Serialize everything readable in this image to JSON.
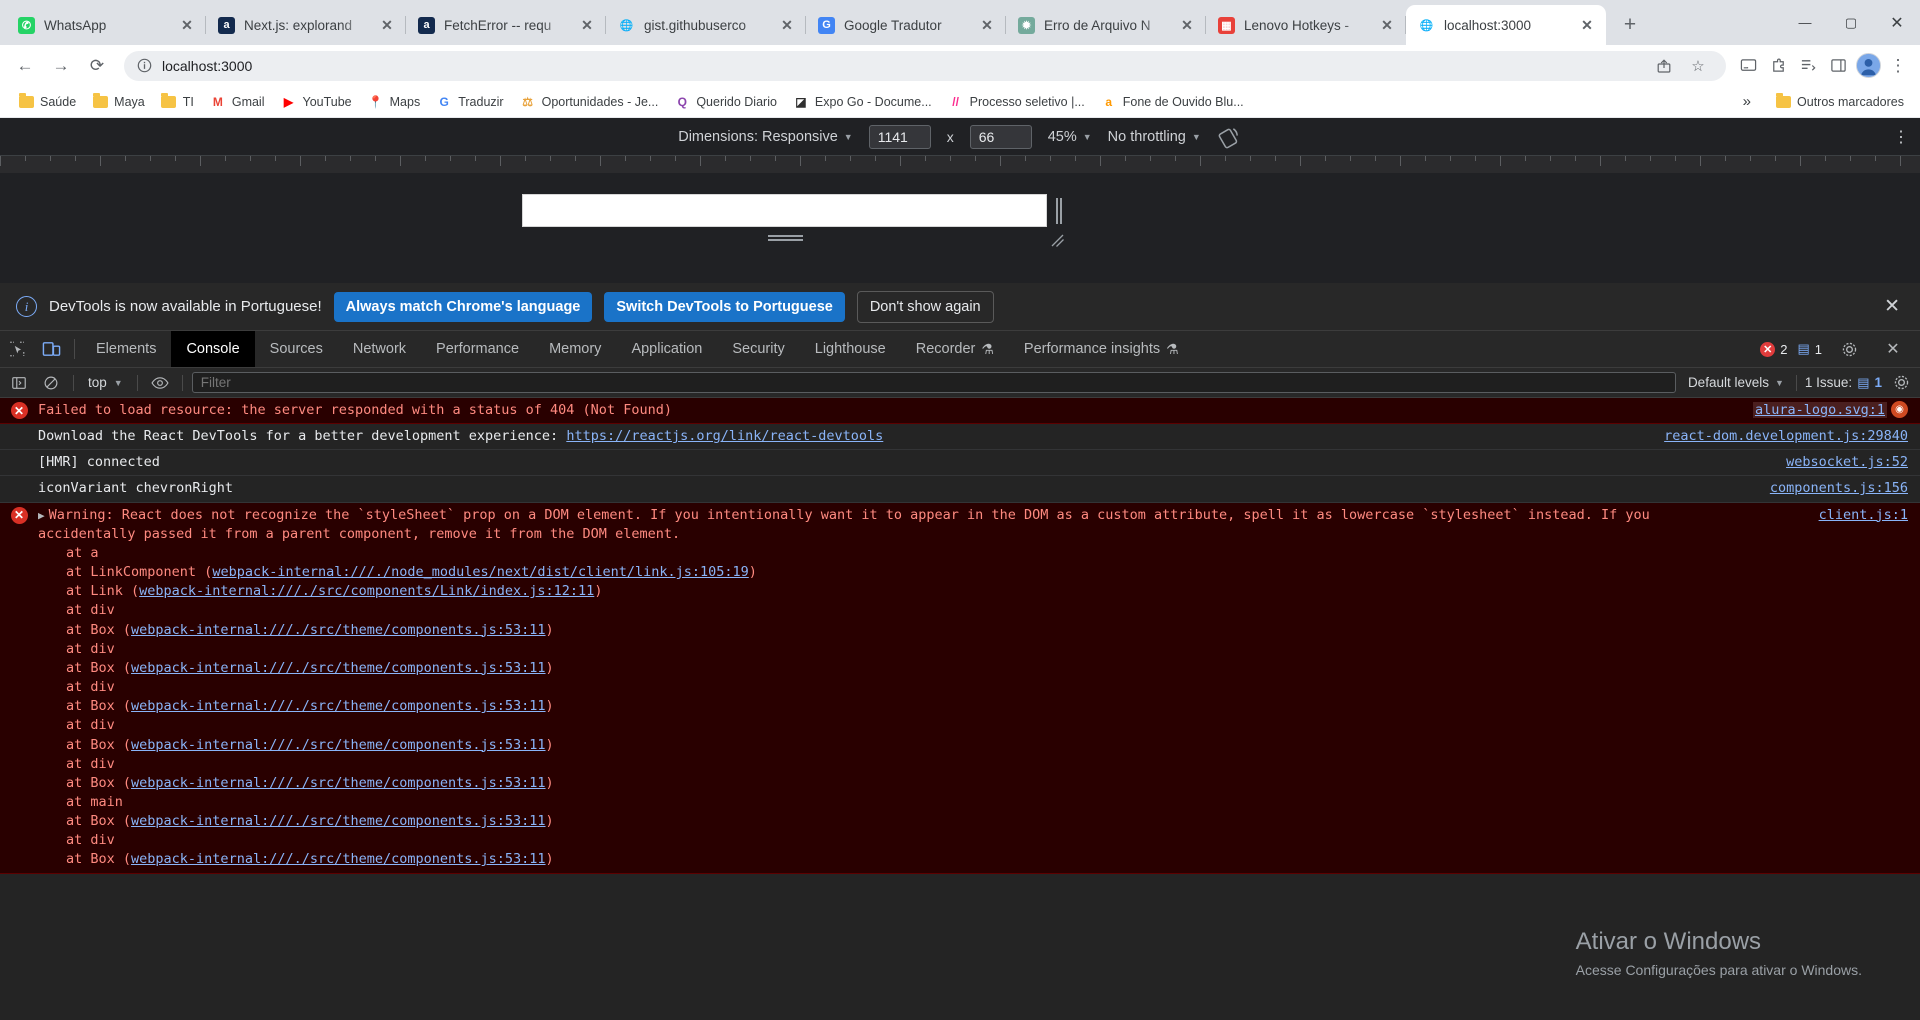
{
  "browser": {
    "tabs": [
      {
        "title": "WhatsApp",
        "favicon": "whatsapp-icon",
        "color": "#25d366",
        "glyph": "✆",
        "active": false
      },
      {
        "title": "Next.js: explorand",
        "favicon": "alura-icon",
        "color": "#132a4e",
        "glyph": "a",
        "active": false
      },
      {
        "title": "FetchError -- requ",
        "favicon": "alura-icon",
        "color": "#132a4e",
        "glyph": "a",
        "active": false
      },
      {
        "title": "gist.githubuserco",
        "favicon": "globe-icon",
        "color": "#c9cdd2",
        "glyph": "🌐",
        "active": false
      },
      {
        "title": "Google Tradutor",
        "favicon": "google-translate-icon",
        "color": "#4285f4",
        "glyph": "G",
        "active": false
      },
      {
        "title": "Erro de Arquivo N",
        "favicon": "chatgpt-icon",
        "color": "#74aa9c",
        "glyph": "✹",
        "active": false
      },
      {
        "title": "Lenovo Hotkeys -",
        "favicon": "microsoft-store-icon",
        "color": "#e8413a",
        "glyph": "▦",
        "active": false
      },
      {
        "title": "localhost:3000",
        "favicon": "globe-icon",
        "color": "#c9cdd2",
        "glyph": "🌐",
        "active": true
      }
    ],
    "new_tab_label": "+",
    "window_controls": {
      "minimize": "—",
      "maximize": "▢",
      "close": "✕"
    },
    "toolbar": {
      "back": "←",
      "forward": "→",
      "reload": "⟳",
      "site_info_icon": "info-circle-icon",
      "url": "localhost:3000",
      "share_icon": "↥",
      "bookmark_icon": "☆",
      "cast_icon": "▭",
      "extensions_icon": "🧩",
      "reading_list_icon": "☰",
      "side_panel_icon": "◫",
      "profile_icon": "avatar",
      "menu_icon": "⋮"
    },
    "bookmarks": [
      {
        "label": "Saúde",
        "icon": "folder-icon"
      },
      {
        "label": "Maya",
        "icon": "folder-icon"
      },
      {
        "label": "TI",
        "icon": "folder-icon"
      },
      {
        "label": "Gmail",
        "icon": "gmail-icon",
        "glyph": "M",
        "color": "#ea4335"
      },
      {
        "label": "YouTube",
        "icon": "youtube-icon",
        "glyph": "▶",
        "color": "#ff0000"
      },
      {
        "label": "Maps",
        "icon": "maps-icon",
        "glyph": "📍",
        "color": "#34a853"
      },
      {
        "label": "Traduzir",
        "icon": "google-translate-icon",
        "glyph": "G",
        "color": "#4285f4"
      },
      {
        "label": "Oportunidades - Je...",
        "icon": "scale-icon",
        "glyph": "⚖",
        "color": "#e8a33d"
      },
      {
        "label": "Querido Diario",
        "icon": "querido-diario-icon",
        "glyph": "Q",
        "color": "#8b44ad"
      },
      {
        "label": "Expo Go - Docume...",
        "icon": "expo-icon",
        "glyph": "◪",
        "color": "#2f2f2f"
      },
      {
        "label": "Processo seletivo |...",
        "icon": "gitlab-icon",
        "glyph": "//",
        "color": "#fc2c8f"
      },
      {
        "label": "Fone de Ouvido Blu...",
        "icon": "amazon-icon",
        "glyph": "a",
        "color": "#ff9900"
      }
    ],
    "bookmarks_overflow": "»",
    "other_bookmarks": "Outros marcadores"
  },
  "device_toolbar": {
    "dimensions_label": "Dimensions: Responsive",
    "width": "1141",
    "times": "x",
    "height": "66",
    "zoom": "45%",
    "throttling": "No throttling",
    "rotate_icon": "rotate-device-icon",
    "menu_icon": "⋮"
  },
  "language_banner": {
    "message": "DevTools is now available in Portuguese!",
    "always_match": "Always match Chrome's language",
    "switch": "Switch DevTools to Portuguese",
    "dismiss": "Don't show again",
    "close": "✕"
  },
  "devtools": {
    "inspect_icon": "inspect-element-icon",
    "device_icon": "toggle-device-toolbar-icon",
    "tabs": [
      {
        "label": "Elements",
        "active": false
      },
      {
        "label": "Console",
        "active": true
      },
      {
        "label": "Sources",
        "active": false
      },
      {
        "label": "Network",
        "active": false
      },
      {
        "label": "Performance",
        "active": false
      },
      {
        "label": "Memory",
        "active": false
      },
      {
        "label": "Application",
        "active": false
      },
      {
        "label": "Security",
        "active": false
      },
      {
        "label": "Lighthouse",
        "active": false
      },
      {
        "label": "Recorder",
        "active": false,
        "beaker": true
      },
      {
        "label": "Performance insights",
        "active": false,
        "beaker": true
      }
    ],
    "error_count": "2",
    "message_count": "1",
    "settings_icon": "gear-icon",
    "close_icon": "✕",
    "console_toolbar": {
      "sidebar_icon": "show-console-sidebar-icon",
      "clear_icon": "clear-console-icon",
      "context": "top",
      "eye_icon": "live-expression-icon",
      "filter_placeholder": "Filter",
      "levels": "Default levels",
      "issues_label": "1 Issue:",
      "issues_count": "1",
      "console_settings_icon": "gear-icon"
    }
  },
  "console_messages": [
    {
      "type": "error",
      "text": "Failed to load resource: the server responded with a status of 404 (Not Found)",
      "source": "alura-logo.svg:1",
      "has_badge": true
    },
    {
      "type": "info",
      "text": "Download the React DevTools for a better development experience: ",
      "link": "https://reactjs.org/link/react-devtools",
      "source": "react-dom.development.js:29840"
    },
    {
      "type": "info",
      "text": "[HMR] connected",
      "source": "websocket.js:52"
    },
    {
      "type": "info",
      "text": "iconVariant chevronRight",
      "source": "components.js:156"
    },
    {
      "type": "error",
      "expandable": true,
      "text": "Warning: React does not recognize the `styleSheet` prop on a DOM element. If you intentionally want it to appear in the DOM as a custom attribute, spell it as lowercase `stylesheet` instead. If you accidentally passed it from a parent component, remove it from the DOM element.",
      "source": "client.js:1",
      "stack": [
        {
          "at": "at a",
          "link": ""
        },
        {
          "at": "at LinkComponent (",
          "link": "webpack-internal:///./node_modules/next/dist/client/link.js:105:19",
          "close": ")"
        },
        {
          "at": "at Link (",
          "link": "webpack-internal:///./src/components/Link/index.js:12:11",
          "close": ")"
        },
        {
          "at": "at div",
          "link": ""
        },
        {
          "at": "at Box (",
          "link": "webpack-internal:///./src/theme/components.js:53:11",
          "close": ")"
        },
        {
          "at": "at div",
          "link": ""
        },
        {
          "at": "at Box (",
          "link": "webpack-internal:///./src/theme/components.js:53:11",
          "close": ")"
        },
        {
          "at": "at div",
          "link": ""
        },
        {
          "at": "at Box (",
          "link": "webpack-internal:///./src/theme/components.js:53:11",
          "close": ")"
        },
        {
          "at": "at div",
          "link": ""
        },
        {
          "at": "at Box (",
          "link": "webpack-internal:///./src/theme/components.js:53:11",
          "close": ")"
        },
        {
          "at": "at div",
          "link": ""
        },
        {
          "at": "at Box (",
          "link": "webpack-internal:///./src/theme/components.js:53:11",
          "close": ")"
        },
        {
          "at": "at main",
          "link": ""
        },
        {
          "at": "at Box (",
          "link": "webpack-internal:///./src/theme/components.js:53:11",
          "close": ")"
        },
        {
          "at": "at div",
          "link": ""
        },
        {
          "at": "at Box (",
          "link": "webpack-internal:///./src/theme/components.js:53:11",
          "close": ")"
        }
      ]
    }
  ],
  "watermark": {
    "line1": "Ativar o Windows",
    "line2": "Acesse Configurações para ativar o Windows."
  }
}
